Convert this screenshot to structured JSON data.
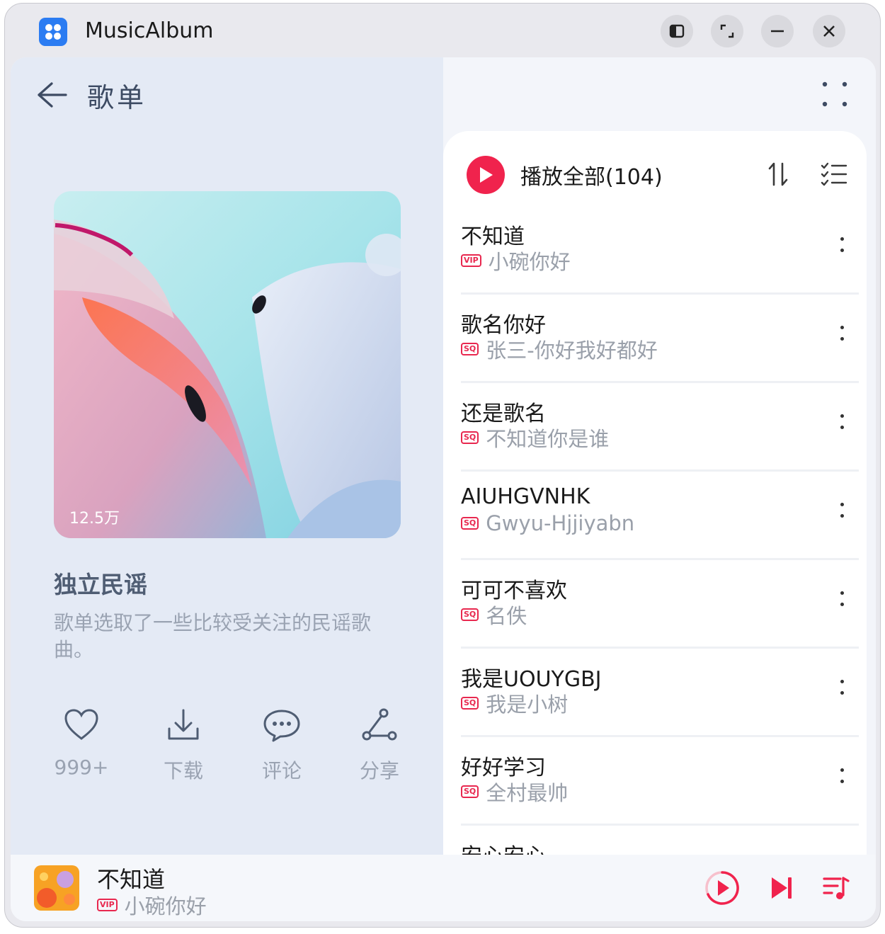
{
  "window": {
    "app_title": "MusicAlbum",
    "controls": [
      "split-view",
      "maximize",
      "minimize",
      "close"
    ]
  },
  "header": {
    "back_icon": "back-arrow-icon",
    "title": "歌单",
    "more_icon": "more-grid-icon"
  },
  "playlist": {
    "play_count": "12.5万",
    "name": "独立民谣",
    "description": "歌单选取了一些比较受关注的民谣歌曲。",
    "actions": [
      {
        "icon": "heart-icon",
        "label": "999+"
      },
      {
        "icon": "download-icon",
        "label": "下载"
      },
      {
        "icon": "comment-icon",
        "label": "评论"
      },
      {
        "icon": "share-icon",
        "label": "分享"
      }
    ]
  },
  "list": {
    "play_all_label": "播放全部(104)",
    "play_all_color": "#f0234d",
    "songs": [
      {
        "title": "不知道",
        "badge": "VIP",
        "artist": "小碗你好"
      },
      {
        "title": "歌名你好",
        "badge": "SQ",
        "artist": "张三-你好我好都好"
      },
      {
        "title": "还是歌名",
        "badge": "SQ",
        "artist": "不知道你是谁"
      },
      {
        "title": "AIUHGVNHK",
        "badge": "SQ",
        "artist": "Gwyu-Hjjiyabn"
      },
      {
        "title": "可可不喜欢",
        "badge": "SQ",
        "artist": "名佚"
      },
      {
        "title": "我是UOUYGBJ",
        "badge": "SQ",
        "artist": "我是小树"
      },
      {
        "title": "好好学习",
        "badge": "SQ",
        "artist": "全村最帅"
      },
      {
        "title": "安心安心",
        "badge": "",
        "artist": ""
      }
    ]
  },
  "player": {
    "title": "不知道",
    "badge": "VIP",
    "artist": "小碗你好",
    "accent": "#f0234d"
  }
}
